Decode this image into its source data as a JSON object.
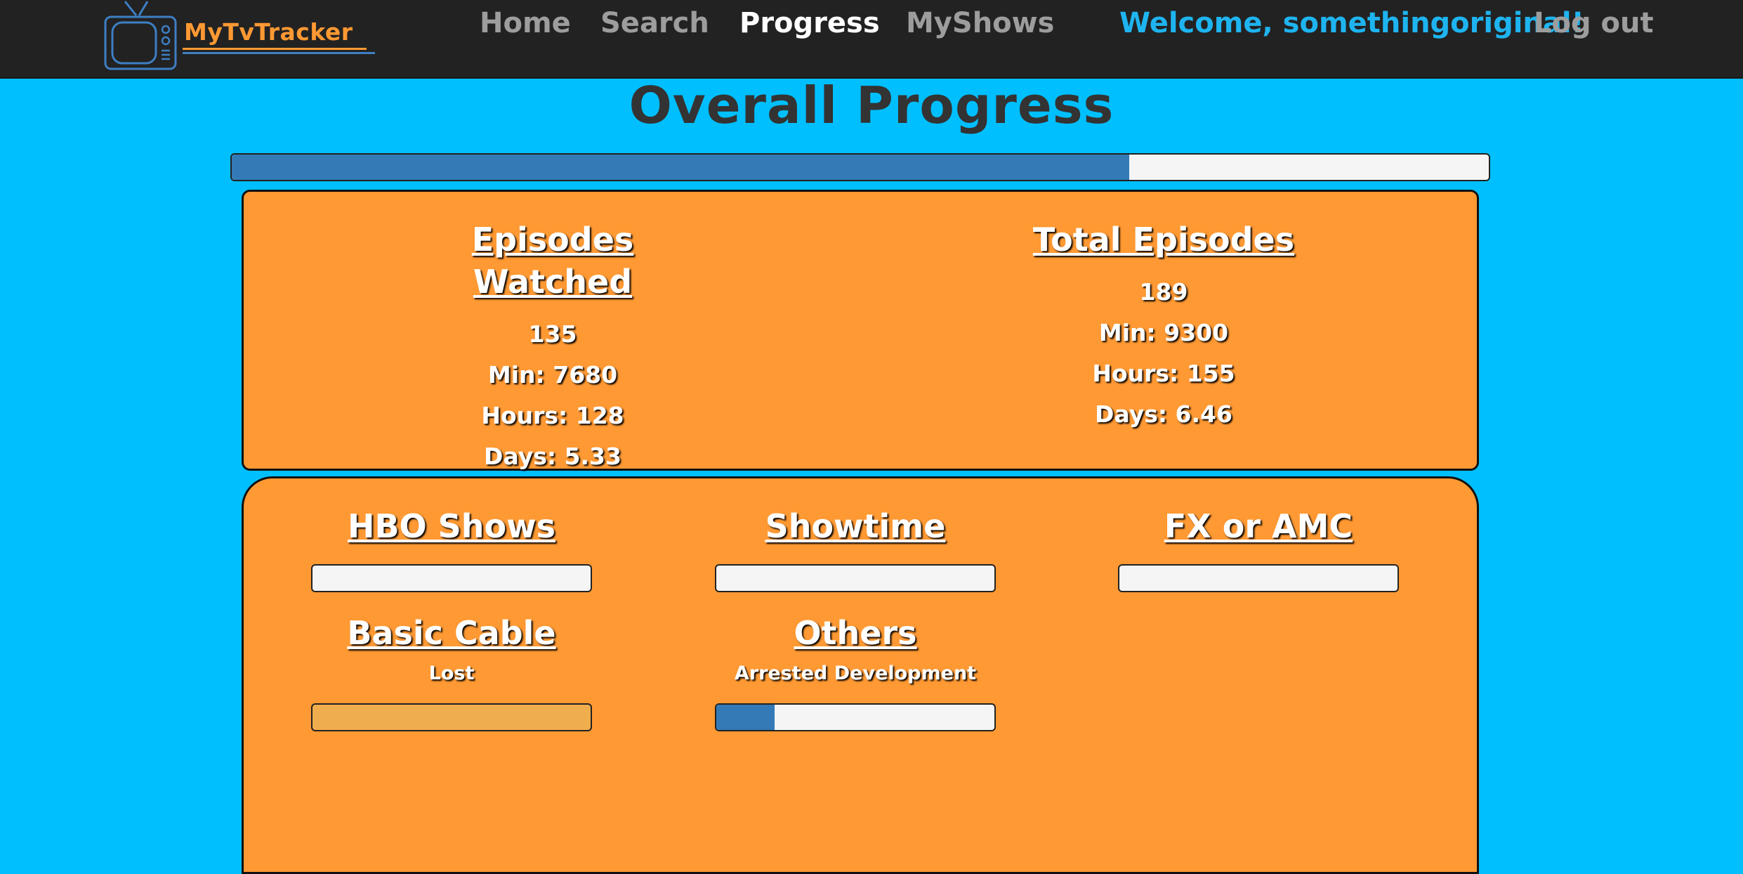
{
  "navbar": {
    "logo_text": "MyTvTracker",
    "items": [
      {
        "label": "Home",
        "active": false
      },
      {
        "label": "Search",
        "active": false
      },
      {
        "label": "Progress",
        "active": true
      },
      {
        "label": "MyShows",
        "active": false
      }
    ],
    "welcome": "Welcome, somethingoriginal!",
    "logout_label": "Log out"
  },
  "page": {
    "title": "Overall Progress",
    "overall_progress": 0.714
  },
  "stats": {
    "watched": {
      "heading": "Episodes Watched",
      "episodes": "135",
      "minutes": "Min: 7680",
      "hours": "Hours: 128",
      "days": "Days: 5.33"
    },
    "total": {
      "heading": "Total Episodes",
      "episodes": "189",
      "minutes": "Min: 9300",
      "hours": "Hours: 155",
      "days": "Days: 6.46"
    }
  },
  "categories": [
    {
      "heading": "HBO Shows",
      "show": "",
      "progress": 0
    },
    {
      "heading": "Showtime",
      "show": "",
      "progress": 0
    },
    {
      "heading": "FX or AMC",
      "show": "",
      "progress": 0
    },
    {
      "heading": "Basic Cable",
      "show": "Lost",
      "progress": 0
    },
    {
      "heading": "Others",
      "show": "Arrested Development",
      "progress": 0.21
    }
  ],
  "colors": {
    "background": "#00bfff",
    "navbar": "#222222",
    "accent_orange": "#ff9933",
    "progress_blue": "#337ab7",
    "welcome_blue": "#1eb4f0"
  }
}
